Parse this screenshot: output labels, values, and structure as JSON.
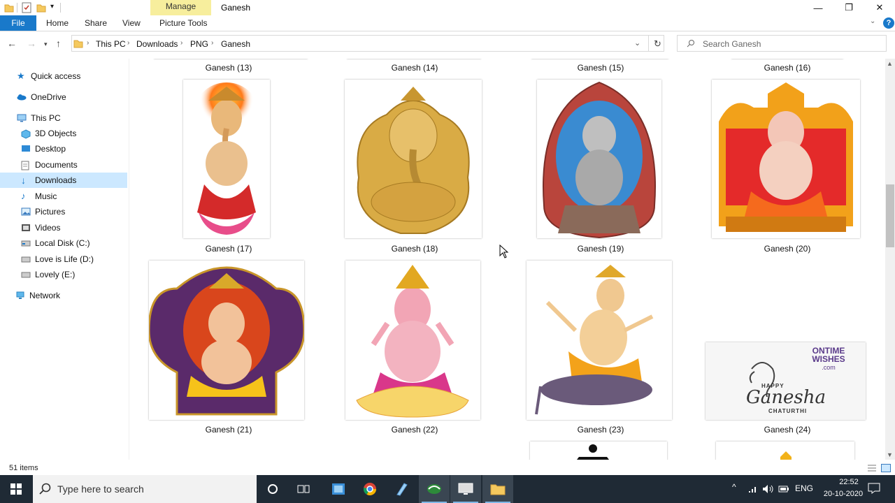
{
  "window": {
    "title": "Ganesh",
    "manage_label": "Manage",
    "minimize": "—",
    "maximize": "❐",
    "close": "✕"
  },
  "ribbon": {
    "file": "File",
    "tabs": [
      "Home",
      "Share",
      "View",
      "Picture Tools"
    ],
    "help": "?"
  },
  "address": {
    "crumbs": [
      "This PC",
      "Downloads",
      "PNG",
      "Ganesh"
    ],
    "search_placeholder": "Search Ganesh"
  },
  "sidebar": {
    "quick_access": "Quick access",
    "onedrive": "OneDrive",
    "this_pc": "This PC",
    "items": [
      "3D Objects",
      "Desktop",
      "Documents",
      "Downloads",
      "Music",
      "Pictures",
      "Videos",
      "Local Disk (C:)",
      "Love is Life (D:)",
      "Lovely (E:)"
    ],
    "network": "Network",
    "selected": "Downloads"
  },
  "files": {
    "top_row": [
      "Ganesh (13)",
      "Ganesh (14)",
      "Ganesh (15)",
      "Ganesh (16)"
    ],
    "row1": [
      "Ganesh (17)",
      "Ganesh (18)",
      "Ganesh (19)",
      "Ganesh (20)"
    ],
    "row2": [
      "Ganesh (21)",
      "Ganesh (22)",
      "Ganesh (23)",
      "Ganesh (24)"
    ],
    "thumb24_text": {
      "brand_line1": "ONTIME",
      "brand_line2": "WISHES",
      "brand_line3": ".com",
      "happy": "HAPPY",
      "ganesha": "Ganesha",
      "chaturthi": "CHATURTHI"
    }
  },
  "status": {
    "items": "51 items"
  },
  "taskbar": {
    "search": "Type here to search",
    "time": "22:52",
    "date": "20-10-2020",
    "lang": "ENG"
  },
  "colors": {
    "accent": "#1979ca",
    "selected": "#cce8ff",
    "manage": "#f7ee9d",
    "taskbar": "#1f2a35"
  }
}
